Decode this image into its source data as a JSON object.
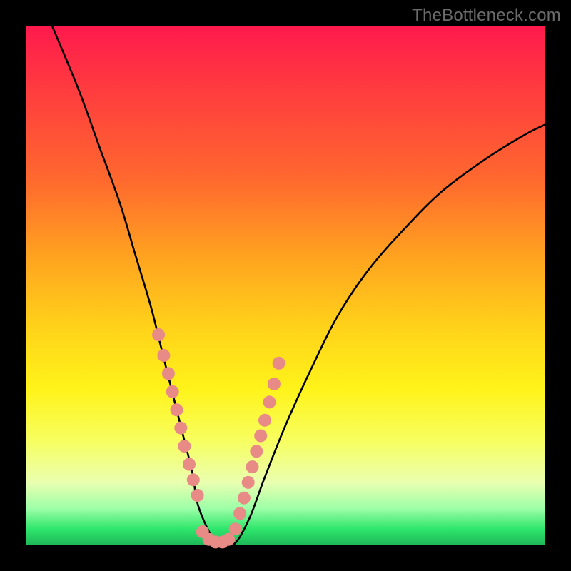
{
  "watermark": "TheBottleneck.com",
  "chart_data": {
    "type": "line",
    "title": "",
    "xlabel": "",
    "ylabel": "",
    "xlim": [
      0,
      100
    ],
    "ylim": [
      0,
      100
    ],
    "series": [
      {
        "name": "bottleneck-curve",
        "x": [
          5,
          10,
          14,
          18,
          21,
          24,
          26,
          28,
          30,
          32,
          33,
          35,
          37,
          40,
          43,
          46,
          50,
          55,
          60,
          66,
          73,
          80,
          88,
          96,
          100
        ],
        "values": [
          100,
          88,
          77,
          66,
          56,
          46,
          38,
          30,
          22,
          14,
          8,
          3,
          0,
          0,
          5,
          13,
          23,
          34,
          44,
          53,
          61,
          68,
          74,
          79,
          81
        ]
      }
    ],
    "markers": {
      "name": "highlight-dots",
      "color": "#e88a85",
      "x_left": [
        25.5,
        26.5,
        27.4,
        28.2,
        29.0,
        29.8,
        30.5,
        31.4,
        32.2,
        33.0
      ],
      "y_left": [
        40.5,
        36.5,
        33.0,
        29.5,
        26.0,
        22.5,
        19.0,
        15.5,
        12.5,
        9.5
      ],
      "x_bottom": [
        34.0,
        35.2,
        36.5,
        37.8,
        39.0
      ],
      "y_bottom": [
        2.5,
        1.0,
        0.5,
        0.5,
        1.0
      ],
      "x_right": [
        40.3,
        41.2,
        42.0,
        42.8,
        43.6,
        44.4,
        45.2,
        46.0,
        46.9,
        47.8,
        48.7
      ],
      "y_right": [
        3.0,
        6.0,
        9.0,
        12.0,
        15.0,
        18.0,
        21.0,
        24.0,
        27.5,
        31.0,
        35.0
      ]
    },
    "gradient_stops": [
      {
        "pos": 0,
        "color": "#ff1a4d"
      },
      {
        "pos": 12,
        "color": "#ff3b3f"
      },
      {
        "pos": 30,
        "color": "#ff6a2e"
      },
      {
        "pos": 45,
        "color": "#ffa51f"
      },
      {
        "pos": 58,
        "color": "#ffd21a"
      },
      {
        "pos": 70,
        "color": "#fff31a"
      },
      {
        "pos": 80,
        "color": "#f7ff60"
      },
      {
        "pos": 88,
        "color": "#eaffb0"
      },
      {
        "pos": 93,
        "color": "#9effa8"
      },
      {
        "pos": 97,
        "color": "#2ee66b"
      },
      {
        "pos": 100,
        "color": "#1fb85a"
      }
    ]
  }
}
